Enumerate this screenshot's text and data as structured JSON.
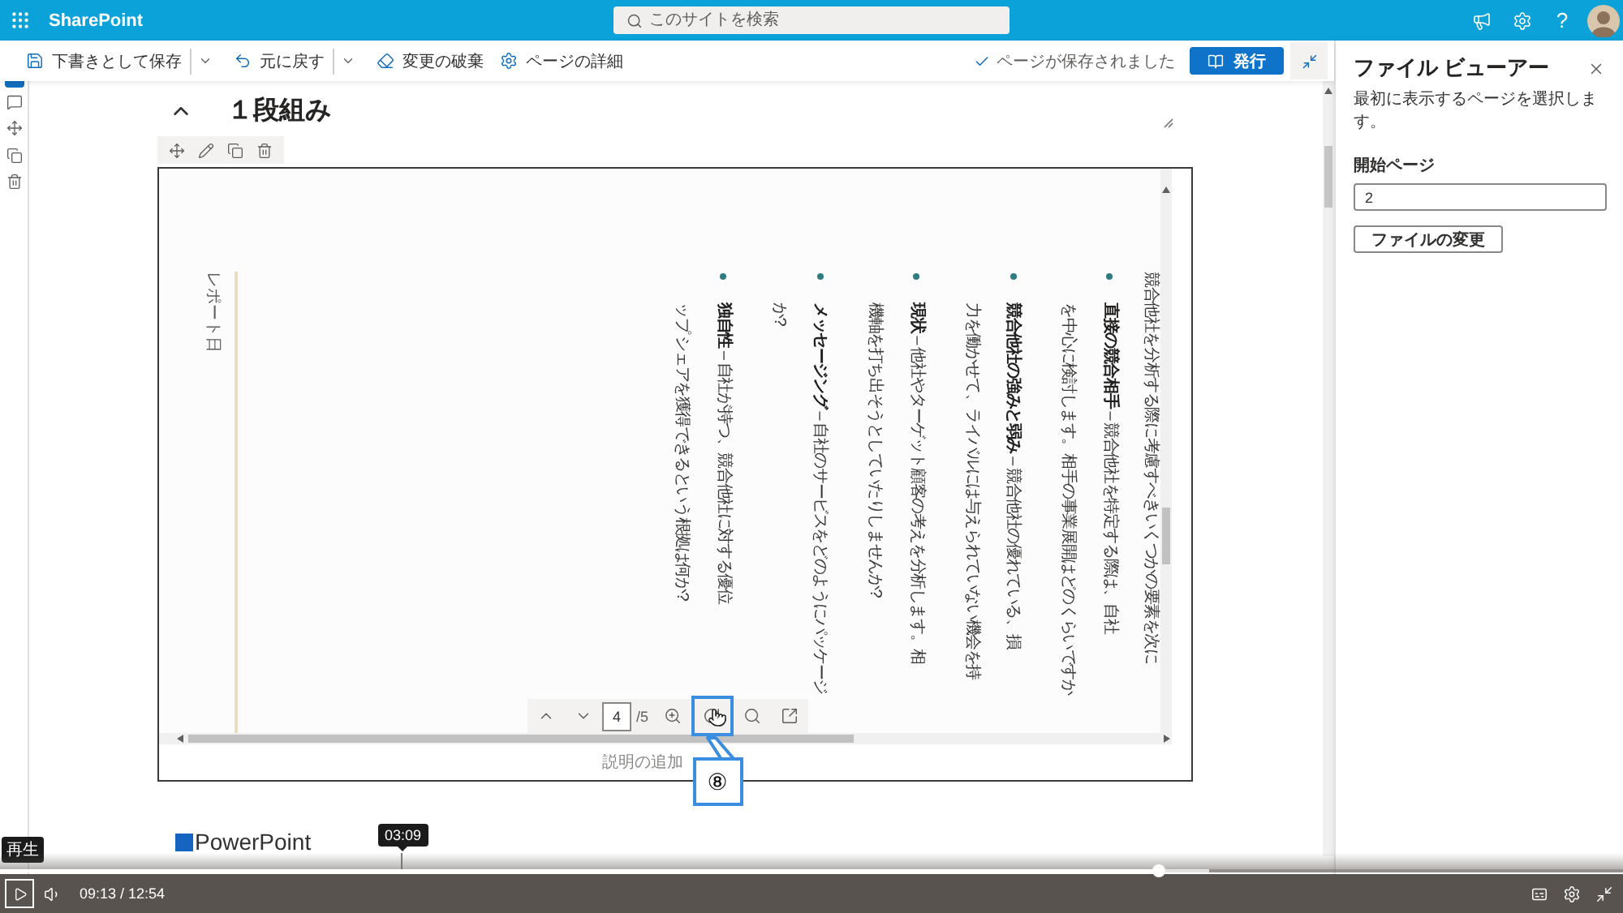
{
  "header": {
    "app_name": "SharePoint",
    "search": {
      "placeholder": "このサイトを検索"
    },
    "help": "?"
  },
  "command_bar": {
    "items": [
      {
        "kind": "save",
        "label": "下書きとして保存",
        "dropdown": true
      },
      {
        "kind": "undo",
        "label": "元に戻す",
        "dropdown": true
      },
      {
        "kind": "discard",
        "label": "変更の破棄",
        "dropdown": false
      },
      {
        "kind": "details",
        "label": "ページの詳細",
        "dropdown": false
      }
    ],
    "status": "ページが保存されました",
    "publish": "発行"
  },
  "section": {
    "title": "１段組み",
    "expanded": true
  },
  "file_viewer": {
    "document": {
      "intro": "競合他社を分析する際に考慮すべきいくつかの要素を次に",
      "bullets": [
        {
          "lines": [
            "**直接の競合相手** – 競合他社を特定する際は、自社",
            "を中心に検討します。相手の事業展開はどのくらいですか"
          ]
        },
        {
          "lines": [
            "**競合他社の強みと弱み** – 競合他社の優れている、損",
            "力を働かせて、ライバルには与えられていない機会を持"
          ]
        },
        {
          "lines": [
            "**現状** – 他社やターゲット顧客の考えを分析します。相",
            "機軸を打ち出そうとしていたりしませんか?"
          ]
        },
        {
          "lines": [
            "**メッセージング** – 自社のサービスをどのようにパッケージ",
            "か?"
          ]
        },
        {
          "lines": [
            "**独自性** – 自社が持つ、競合他社に対する優位",
            "ップ シェアを獲得できるという根拠は何か?"
          ]
        }
      ],
      "footer": "レポート日"
    },
    "toolbar": {
      "nav": [
        {
          "kind": "previous",
          "highlighted": false
        },
        {
          "kind": "next",
          "highlighted": false
        }
      ],
      "page": "4",
      "page_count": "/5",
      "tools": [
        {
          "kind": "zoom-in",
          "highlighted": false
        },
        {
          "kind": "rotate",
          "highlighted": true
        },
        {
          "kind": "search",
          "highlighted": false
        },
        {
          "kind": "popout",
          "highlighted": false
        }
      ]
    },
    "caption": {
      "placeholder": "説明の追加"
    },
    "callout": "⑧"
  },
  "next_section": {
    "title": "PowerPoint"
  },
  "panel": {
    "title": "ファイル ビューアー",
    "description": "最初に表示するページを選択します。",
    "start_page": {
      "label": "開始ページ",
      "value": "2"
    },
    "change_file": "ファイルの変更"
  },
  "player": {
    "play_tooltip": "再生",
    "time": "09:13 / 12:54",
    "progress": {
      "level": 0.714
    },
    "buffer": {
      "level": 0.745
    },
    "hover": {
      "label": "03:09",
      "level": 0.247
    }
  }
}
